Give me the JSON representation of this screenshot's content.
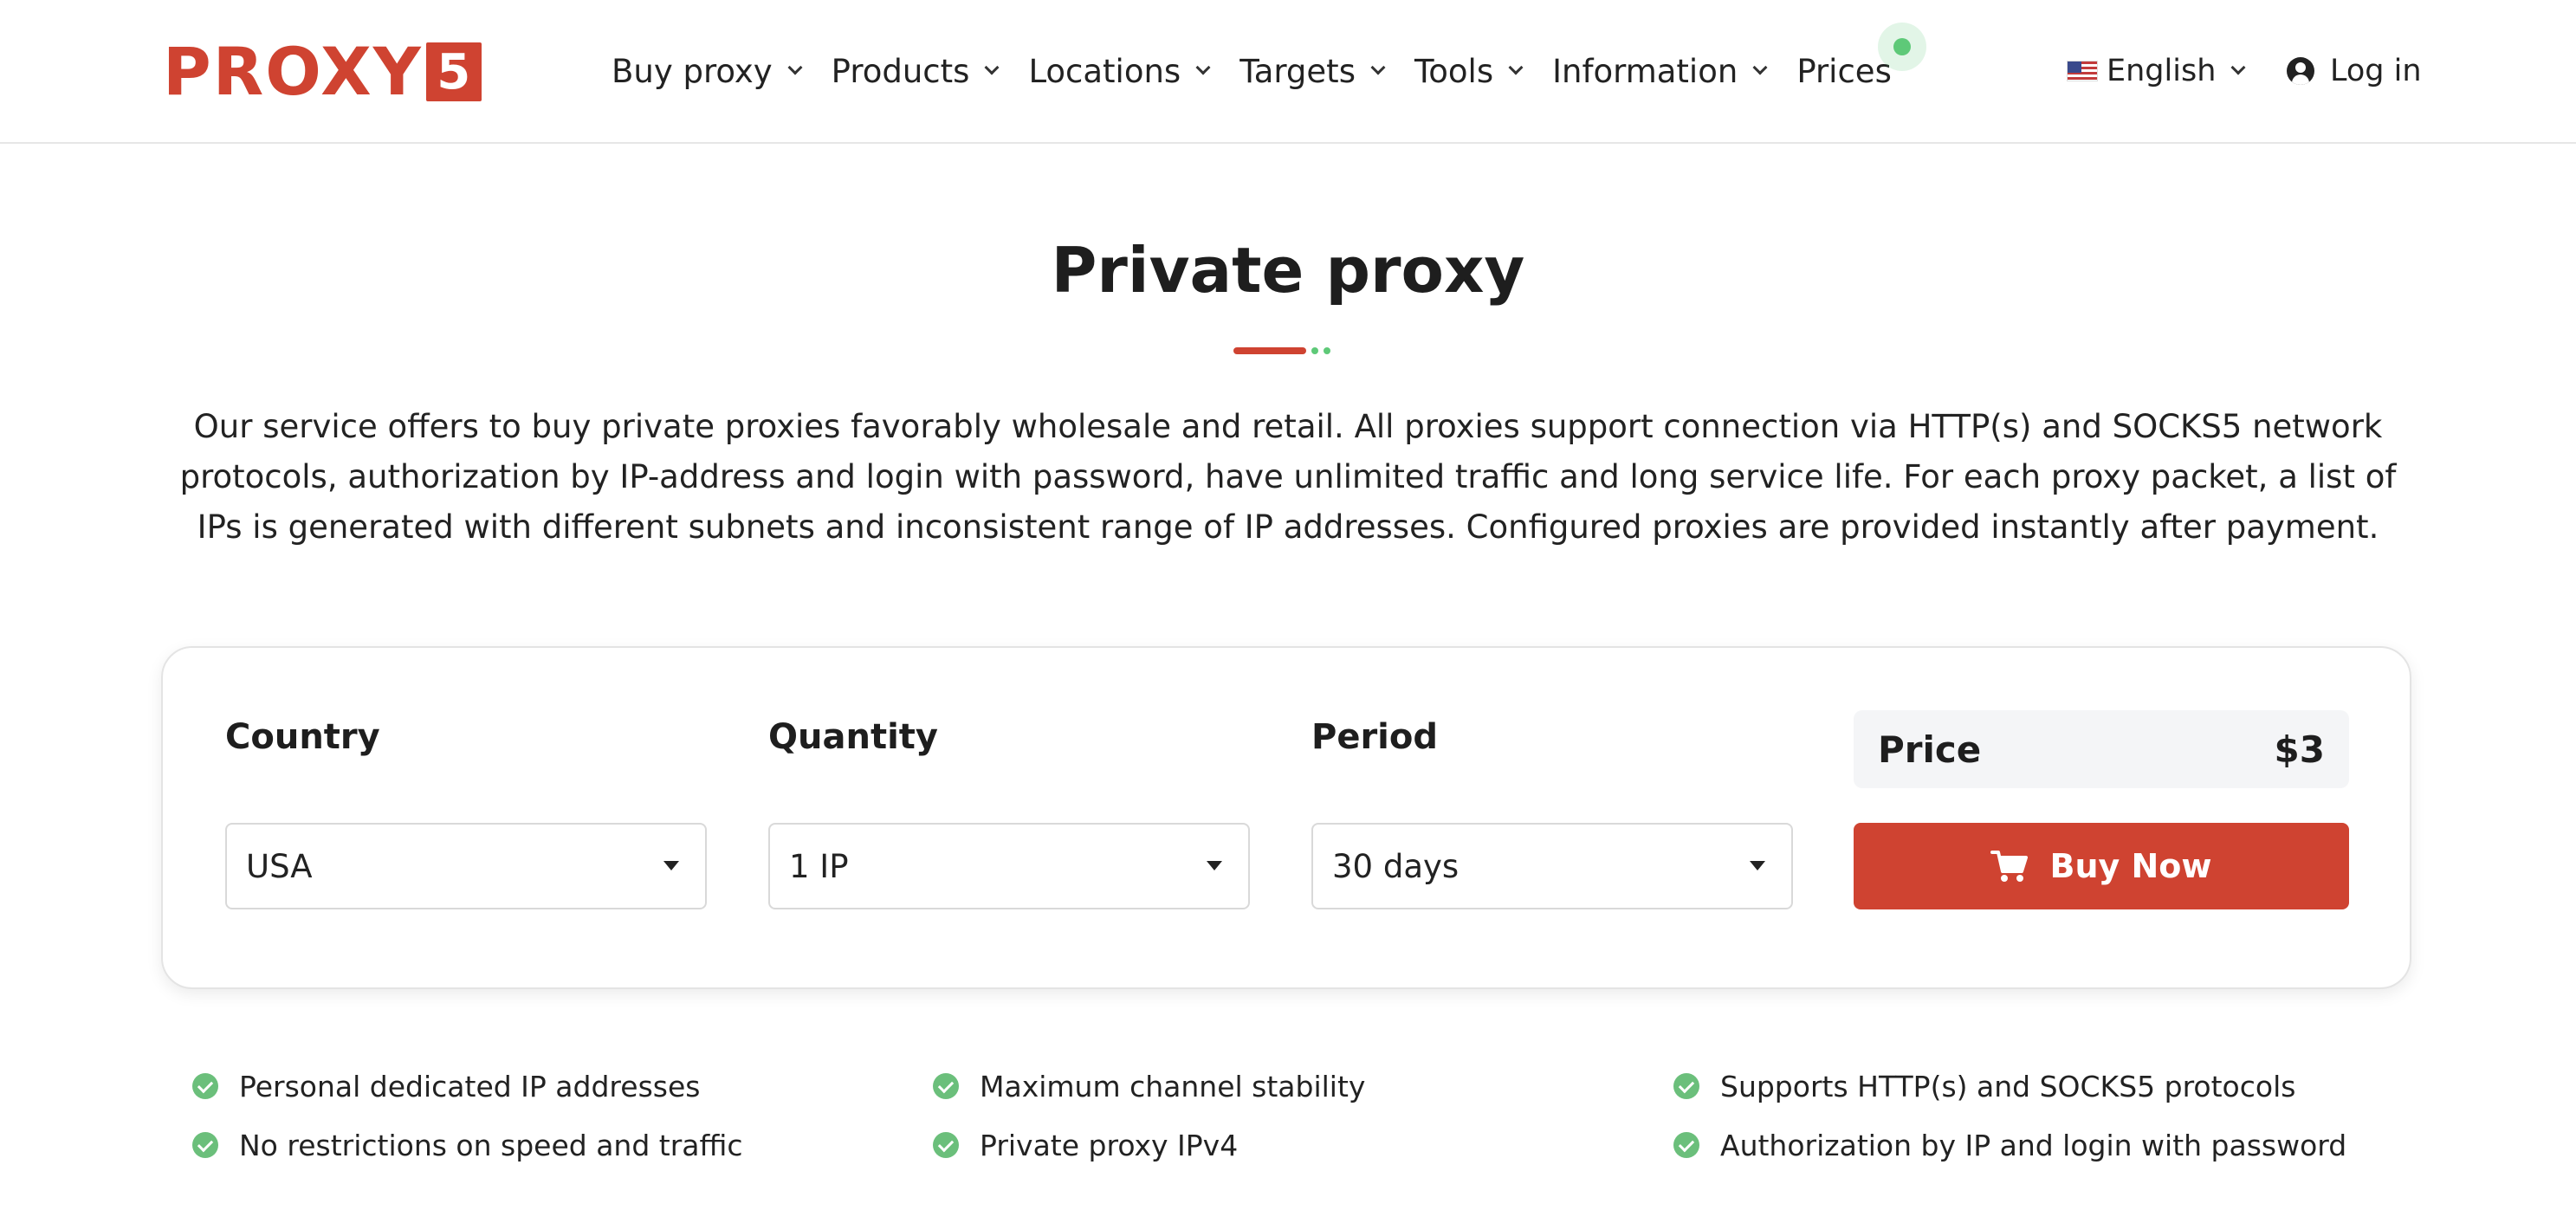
{
  "header": {
    "logo": {
      "text": "PROXY",
      "badge": "5"
    },
    "nav": [
      {
        "label": "Buy proxy",
        "has_dropdown": true
      },
      {
        "label": "Products",
        "has_dropdown": true
      },
      {
        "label": "Locations",
        "has_dropdown": true
      },
      {
        "label": "Targets",
        "has_dropdown": true
      },
      {
        "label": "Tools",
        "has_dropdown": true
      },
      {
        "label": "Information",
        "has_dropdown": true
      },
      {
        "label": "Prices",
        "has_dropdown": false
      }
    ],
    "language": {
      "label": "English",
      "flag": "us-flag-icon"
    },
    "login_label": "Log in"
  },
  "hero": {
    "title": "Private proxy",
    "description": "Our service offers to buy private proxies favorably wholesale and retail. All proxies support connection via HTTP(s) and SOCKS5 network protocols, authorization by IP-address and login with password, have unlimited traffic and long service life. For each proxy packet, a list of IPs is generated with different subnets and inconsistent range of IP addresses. Configured proxies are provided instantly after payment."
  },
  "order": {
    "country": {
      "label": "Country",
      "value": "USA"
    },
    "quantity": {
      "label": "Quantity",
      "value": "1 IP"
    },
    "period": {
      "label": "Period",
      "value": "30 days"
    },
    "price": {
      "label": "Price",
      "value": "$3"
    },
    "buy_label": "Buy Now"
  },
  "features": [
    "Personal dedicated IP addresses",
    "No restrictions on speed and traffic",
    "Maximum channel stability",
    "Private proxy IPv4",
    "Supports HTTP(s) and SOCKS5 protocols",
    "Authorization by IP and login with password"
  ],
  "colors": {
    "brand_red": "#cf4331",
    "accent_green": "#5ec978",
    "check_green": "#6bbf7b",
    "price_bg": "#f4f5f7"
  }
}
